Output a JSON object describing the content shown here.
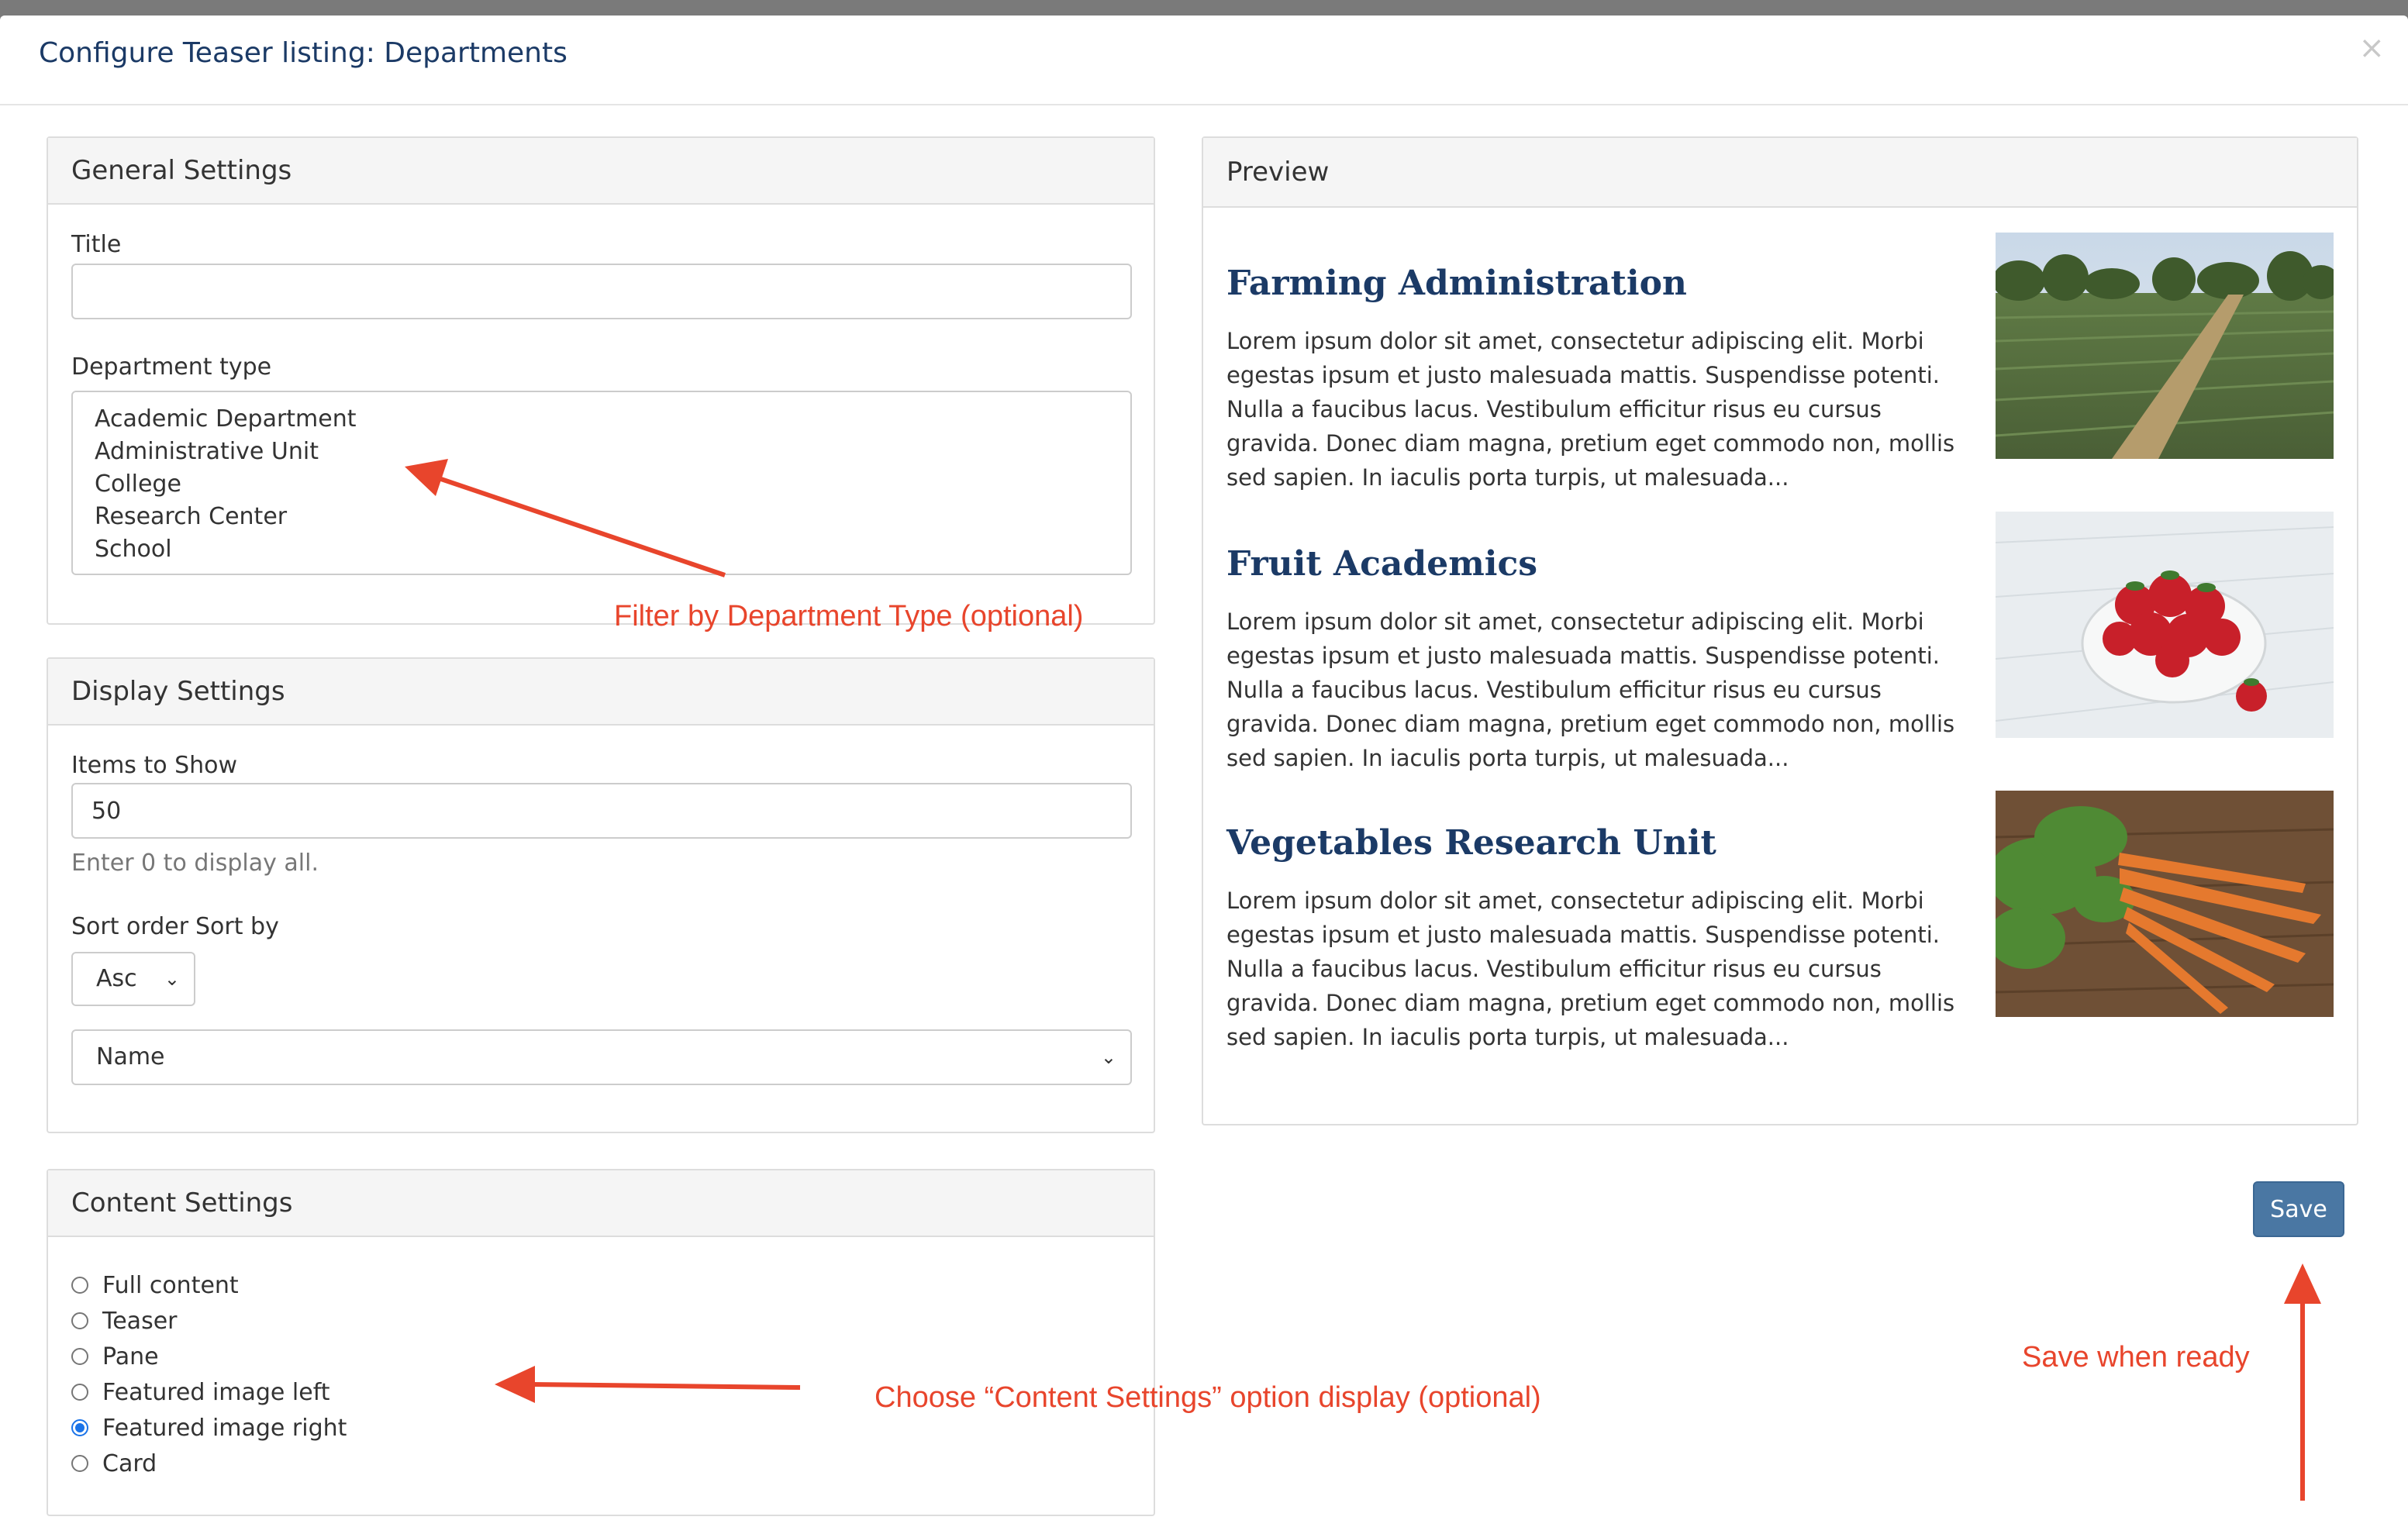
{
  "dialog": {
    "title": "Configure Teaser listing: Departments",
    "close_glyph": "×"
  },
  "general": {
    "heading": "General Settings",
    "title_label": "Title",
    "title_value": "",
    "dept_label": "Department type",
    "dept_options": [
      "Academic Department",
      "Administrative Unit",
      "College",
      "Research Center",
      "School"
    ]
  },
  "display": {
    "heading": "Display Settings",
    "items_label": "Items to Show",
    "items_value": "50",
    "items_help": "Enter 0 to display all.",
    "sort_order_label": "Sort order",
    "sort_by_label": "Sort by",
    "sort_order_value": "Asc",
    "sort_by_value": "Name"
  },
  "content": {
    "heading": "Content Settings",
    "options": [
      "Full content",
      "Teaser",
      "Pane",
      "Featured image left",
      "Featured image right",
      "Card"
    ],
    "selected": "Featured image right"
  },
  "preview": {
    "heading": "Preview",
    "items": [
      {
        "title": "Farming Administration",
        "body": "Lorem ipsum dolor sit amet, consectetur adipiscing elit. Morbi egestas ipsum et justo malesuada mattis. Suspendisse potenti. Nulla a faucibus lacus. Vestibulum efficitur risus eu cursus gravida. Donec diam magna, pretium eget commodo non, mollis sed sapien. In iaculis porta turpis, ut malesuada...",
        "image": "farm-field-photo"
      },
      {
        "title": "Fruit Academics",
        "body": "Lorem ipsum dolor sit amet, consectetur adipiscing elit. Morbi egestas ipsum et justo malesuada mattis. Suspendisse potenti. Nulla a faucibus lacus. Vestibulum efficitur risus eu cursus gravida. Donec diam magna, pretium eget commodo non, mollis sed sapien. In iaculis porta turpis, ut malesuada...",
        "image": "strawberry-bowl-photo"
      },
      {
        "title": "Vegetables Research Unit",
        "body": "Lorem ipsum dolor sit amet, consectetur adipiscing elit. Morbi egestas ipsum et justo malesuada mattis. Suspendisse potenti. Nulla a faucibus lacus. Vestibulum efficitur risus eu cursus gravida. Donec diam magna, pretium eget commodo non, mollis sed sapien. In iaculis porta turpis, ut malesuada...",
        "image": "carrots-photo"
      }
    ]
  },
  "save_label": "Save",
  "annotations": {
    "filter": "Filter by Department Type (optional)",
    "content": "Choose “Content Settings” option display (optional)",
    "save": "Save when ready"
  },
  "colors": {
    "title_blue": "#1b3a66",
    "save_button": "#4a77a3",
    "annotation_red": "#e8452c",
    "radio_blue": "#1a73e8"
  }
}
